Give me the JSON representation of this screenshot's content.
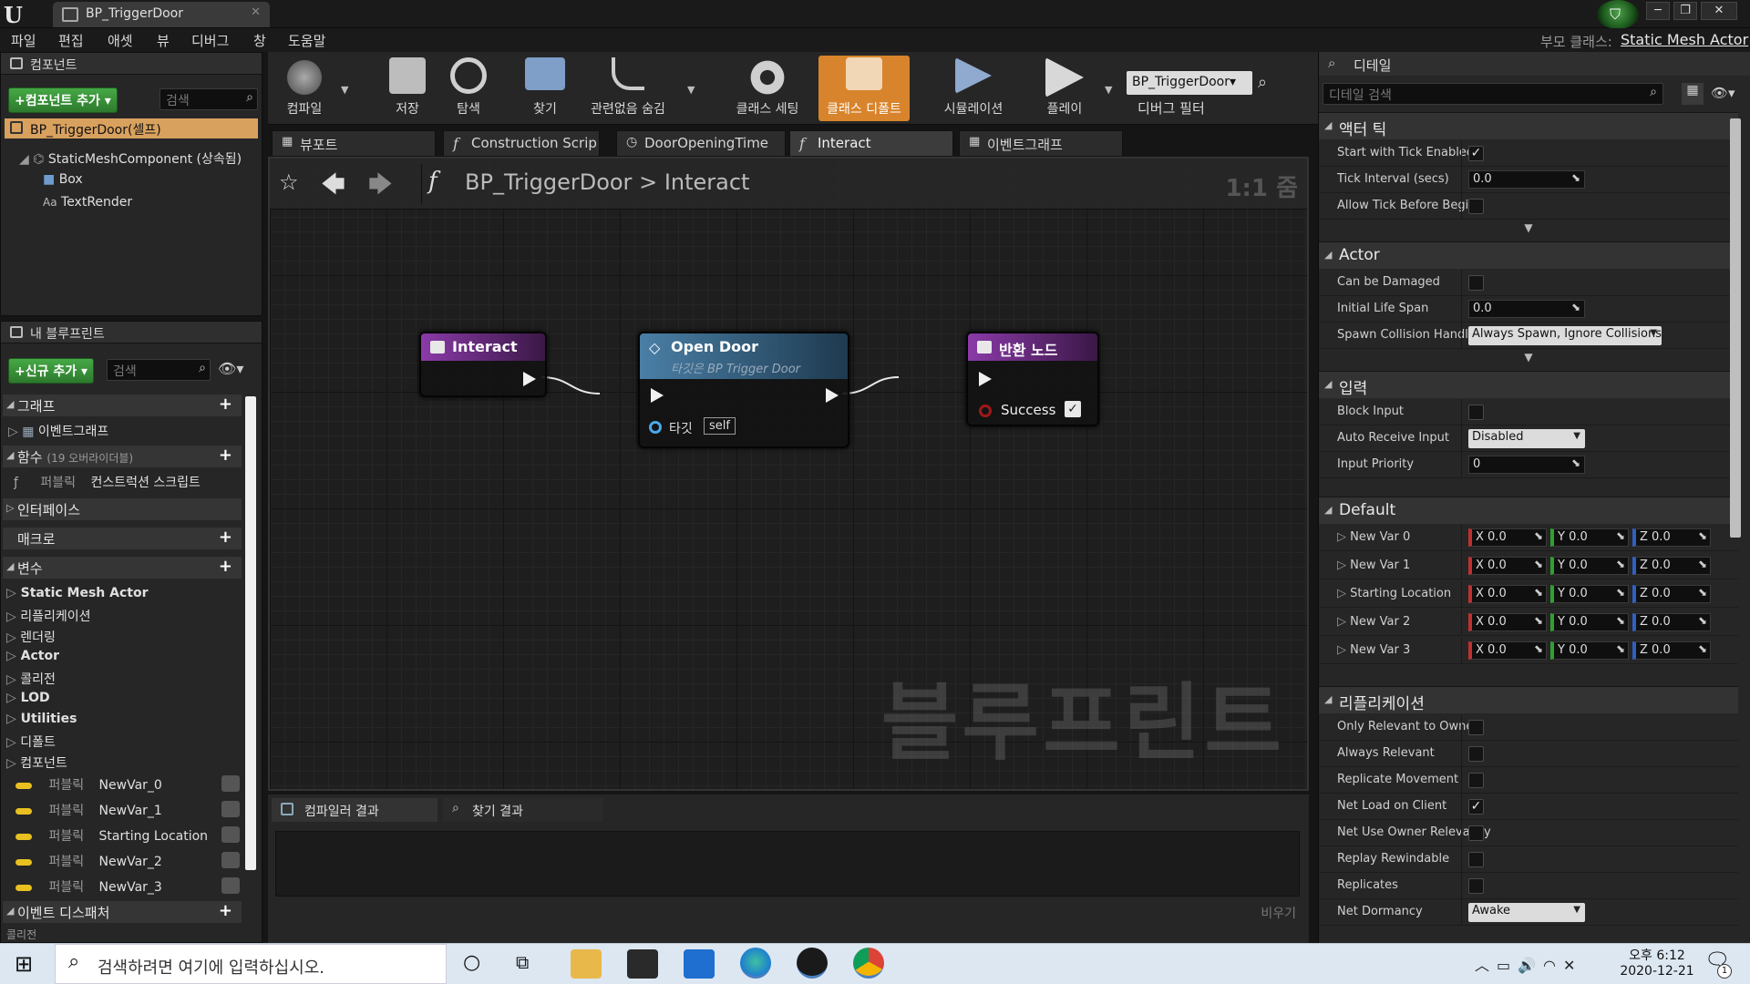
{
  "app": {
    "document_tab": "BP_TriggerDoor",
    "parent_class_label": "부모 클래스:",
    "parent_class_value": "Static Mesh Actor"
  },
  "menu": [
    "파일",
    "편집",
    "애셋",
    "뷰",
    "디버그",
    "창",
    "도움말"
  ],
  "components_panel": {
    "title": "컴포넌트",
    "add_button": "+컴포넌트 추가 ▾",
    "search_placeholder": "검색",
    "root": "BP_TriggerDoor(셀프)",
    "items": [
      "StaticMeshComponent (상속됨)",
      "Box",
      "TextRender"
    ]
  },
  "my_blueprint": {
    "title": "내 블루프린트",
    "add_button": "+신규 추가 ▾",
    "search_placeholder": "검색",
    "graph_section": "그래프",
    "event_graph": "이벤트그래프",
    "functions_section": "함수",
    "functions_overrides": "(19 오버라이더블)",
    "function_item_scope": "퍼블릭",
    "function_item_name": "컨스트럭션 스크립트",
    "interfaces": "인터페이스",
    "macros": "매크로",
    "variables": "변수",
    "var_categories": [
      "Static Mesh Actor",
      "리플리케이션",
      "렌더링",
      "Actor",
      "콜리전",
      "LOD",
      "Utilities",
      "디폴트",
      "컴포넌트"
    ],
    "var_scope": "퍼블릭",
    "vars": [
      "NewVar_0",
      "NewVar_1",
      "Starting Location",
      "NewVar_2",
      "NewVar_3"
    ],
    "event_dispatchers": "이벤트 디스패처",
    "cut_row": "콜리전"
  },
  "toolbar": {
    "buttons": [
      "컴파일",
      "저장",
      "탐색",
      "찾기",
      "관련없음 숨김",
      "클래스 세팅",
      "클래스 디폴트",
      "시뮬레이션",
      "플레이"
    ],
    "debug_select": "BP_TriggerDoor▾",
    "debug_filter": "디버그 필터"
  },
  "doc_tabs": [
    "뷰포트",
    "Construction Scrip",
    "DoorOpeningTime",
    "Interact",
    "이벤트그래프"
  ],
  "graph": {
    "breadcrumb_root": "BP_TriggerDoor",
    "breadcrumb_sep": ">",
    "breadcrumb_leaf": "Interact",
    "zoom": "1:1 줌",
    "watermark": "블루프린트",
    "nodes": {
      "entry": {
        "title": "Interact"
      },
      "call": {
        "title": "Open Door",
        "subtitle": "타깃은 BP Trigger Door",
        "target_label": "타깃",
        "target_value": "self"
      },
      "return": {
        "title": "반환 노드",
        "pin_label": "Success"
      }
    }
  },
  "bottom": {
    "tabs": [
      "컴파일러 결과",
      "찾기 결과"
    ],
    "clear": "비우기"
  },
  "details": {
    "title": "디테일",
    "search_placeholder": "디테일 검색",
    "sections": {
      "actor_tick": {
        "title": "액터 틱",
        "rows": [
          {
            "label": "Start with Tick Enabled",
            "type": "check",
            "value": true
          },
          {
            "label": "Tick Interval (secs)",
            "type": "num",
            "value": "0.0"
          },
          {
            "label": "Allow Tick Before Begin",
            "type": "check",
            "value": false
          }
        ]
      },
      "actor": {
        "title": "Actor",
        "rows": [
          {
            "label": "Can be Damaged",
            "type": "check",
            "value": false
          },
          {
            "label": "Initial Life Span",
            "type": "num",
            "value": "0.0"
          },
          {
            "label": "Spawn Collision Handling",
            "type": "dd",
            "value": "Always Spawn, Ignore Collisions"
          }
        ]
      },
      "input": {
        "title": "입력",
        "rows": [
          {
            "label": "Block Input",
            "type": "check",
            "value": false
          },
          {
            "label": "Auto Receive Input",
            "type": "dd",
            "value": "Disabled"
          },
          {
            "label": "Input Priority",
            "type": "num",
            "value": "0"
          }
        ]
      },
      "default": {
        "title": "Default",
        "rows": [
          {
            "label": "New Var 0",
            "x": "X  0.0",
            "y": "Y  0.0",
            "z": "Z  0.0"
          },
          {
            "label": "New Var 1",
            "x": "X  0.0",
            "y": "Y  0.0",
            "z": "Z  0.0"
          },
          {
            "label": "Starting Location",
            "x": "X  0.0",
            "y": "Y  0.0",
            "z": "Z  0.0"
          },
          {
            "label": "New Var 2",
            "x": "X  0.0",
            "y": "Y  0.0",
            "z": "Z  0.0"
          },
          {
            "label": "New Var 3",
            "x": "X  0.0",
            "y": "Y  0.0",
            "z": "Z  0.0"
          }
        ]
      },
      "replication": {
        "title": "리플리케이션",
        "rows": [
          {
            "label": "Only Relevant to Owner",
            "type": "check",
            "value": false
          },
          {
            "label": "Always Relevant",
            "type": "check",
            "value": false
          },
          {
            "label": "Replicate Movement",
            "type": "check",
            "value": false
          },
          {
            "label": "Net Load on Client",
            "type": "check",
            "value": true
          },
          {
            "label": "Net Use Owner Relevancy",
            "type": "check",
            "value": false
          },
          {
            "label": "Replay Rewindable",
            "type": "check",
            "value": false
          },
          {
            "label": "Replicates",
            "type": "check",
            "value": false
          },
          {
            "label": "Net Dormancy",
            "type": "dd",
            "value": "Awake"
          }
        ]
      }
    }
  },
  "taskbar": {
    "search_placeholder": "검색하려면 여기에 입력하십시오.",
    "time": "오후 6:12",
    "date": "2020-12-21",
    "notif_count": "1"
  },
  "colors": {
    "accent": "#d8842c",
    "function_node": "#7a2e9a",
    "call_node": "#3d6d8f",
    "green": "#2d7a2d"
  }
}
